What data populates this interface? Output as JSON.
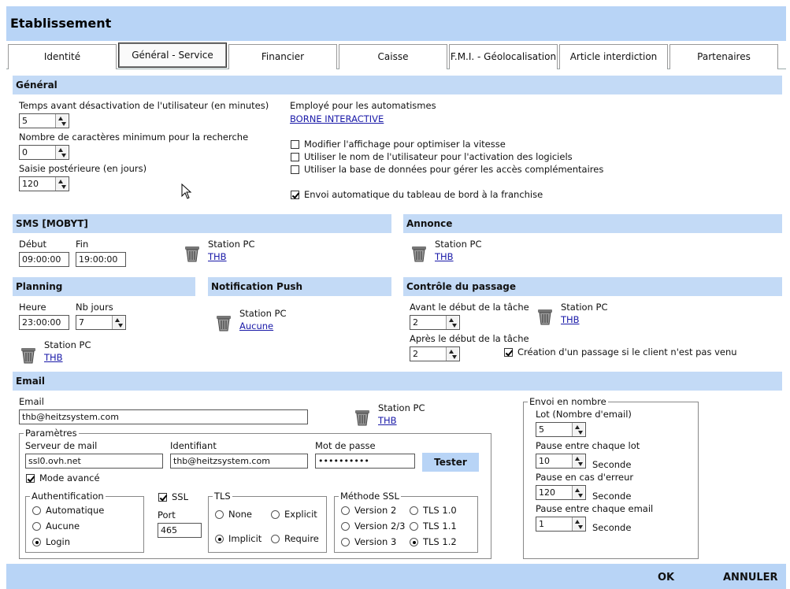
{
  "window": {
    "title": "Etablissement"
  },
  "tabs": [
    "Identité",
    "Général - Service",
    "Financier",
    "Caisse",
    "F.M.I. - Géolocalisation",
    "Article interdiction",
    "Partenaires"
  ],
  "general": {
    "section": "Général",
    "deact_label": "Temps avant désactivation de l'utilisateur (en minutes)",
    "deact_value": "5",
    "minchars_label": "Nombre de caractères minimum pour la recherche",
    "minchars_value": "0",
    "saisie_label": "Saisie postérieure (en jours)",
    "saisie_value": "120",
    "employe_label": "Employé pour les automatismes",
    "employe_link": "BORNE INTERACTIVE",
    "opt1": "Modifier l'affichage pour optimiser la vitesse",
    "opt2": "Utiliser le nom de l'utilisateur pour l'activation des logiciels",
    "opt3": "Utiliser la base de données pour gérer les accès complémentaires",
    "opt4": "Envoi automatique du tableau de bord à la franchise"
  },
  "sms": {
    "section": "SMS [MOBYT]",
    "debut_label": "Début",
    "debut_value": "09:00:00",
    "fin_label": "Fin",
    "fin_value": "19:00:00",
    "station_label": "Station PC",
    "station_link": "THB"
  },
  "annonce": {
    "section": "Annonce",
    "station_label": "Station PC",
    "station_link": "THB"
  },
  "planning": {
    "section": "Planning",
    "heure_label": "Heure",
    "heure_value": "23:00:00",
    "nbjours_label": "Nb jours",
    "nbjours_value": "7",
    "station_label": "Station PC",
    "station_link": "THB"
  },
  "push": {
    "section": "Notification Push",
    "station_label": "Station PC",
    "station_link": "Aucune"
  },
  "passage": {
    "section": "Contrôle du passage",
    "avant_label": "Avant le début de la tâche",
    "avant_value": "2",
    "apres_label": "Après le début de la tâche",
    "apres_value": "2",
    "station_label": "Station PC",
    "station_link": "THB",
    "creation_label": "Création d'un passage si le client n'est pas venu"
  },
  "email": {
    "section": "Email",
    "email_label": "Email",
    "email_value": "thb@heitzsystem.com",
    "station_label": "Station PC",
    "station_link": "THB",
    "params_title": "Paramètres",
    "server_label": "Serveur de mail",
    "server_value": "ssl0.ovh.net",
    "ident_label": "Identifiant",
    "ident_value": "thb@heitzsystem.com",
    "pwd_label": "Mot de passe",
    "pwd_value": "••••••••••",
    "tester": "Tester",
    "mode_avance": "Mode avancé",
    "auth_title": "Authentification",
    "auth_options": [
      "Automatique",
      "Aucune",
      "Login"
    ],
    "ssl_label": "SSL",
    "port_label": "Port",
    "port_value": "465",
    "tls_title": "TLS",
    "tls_none": "None",
    "tls_explicit": "Explicit",
    "tls_implicit": "Implicit",
    "tls_require": "Require",
    "ssl_method_title": "Méthode SSL",
    "ssl_v2": "Version 2",
    "ssl_v23": "Version 2/3",
    "ssl_v3": "Version 3",
    "tls10": "TLS 1.0",
    "tls11": "TLS 1.1",
    "tls12": "TLS 1.2"
  },
  "bulk": {
    "title": "Envoi en nombre",
    "lot_label": "Lot (Nombre d'email)",
    "lot_value": "5",
    "pause_lot_label": "Pause entre chaque lot",
    "pause_lot_value": "10",
    "pause_err_label": "Pause en cas d'erreur",
    "pause_err_value": "120",
    "pause_email_label": "Pause entre chaque email",
    "pause_email_value": "1",
    "seconde": "Seconde"
  },
  "footer": {
    "ok": "OK",
    "annuler": "ANNULER"
  }
}
